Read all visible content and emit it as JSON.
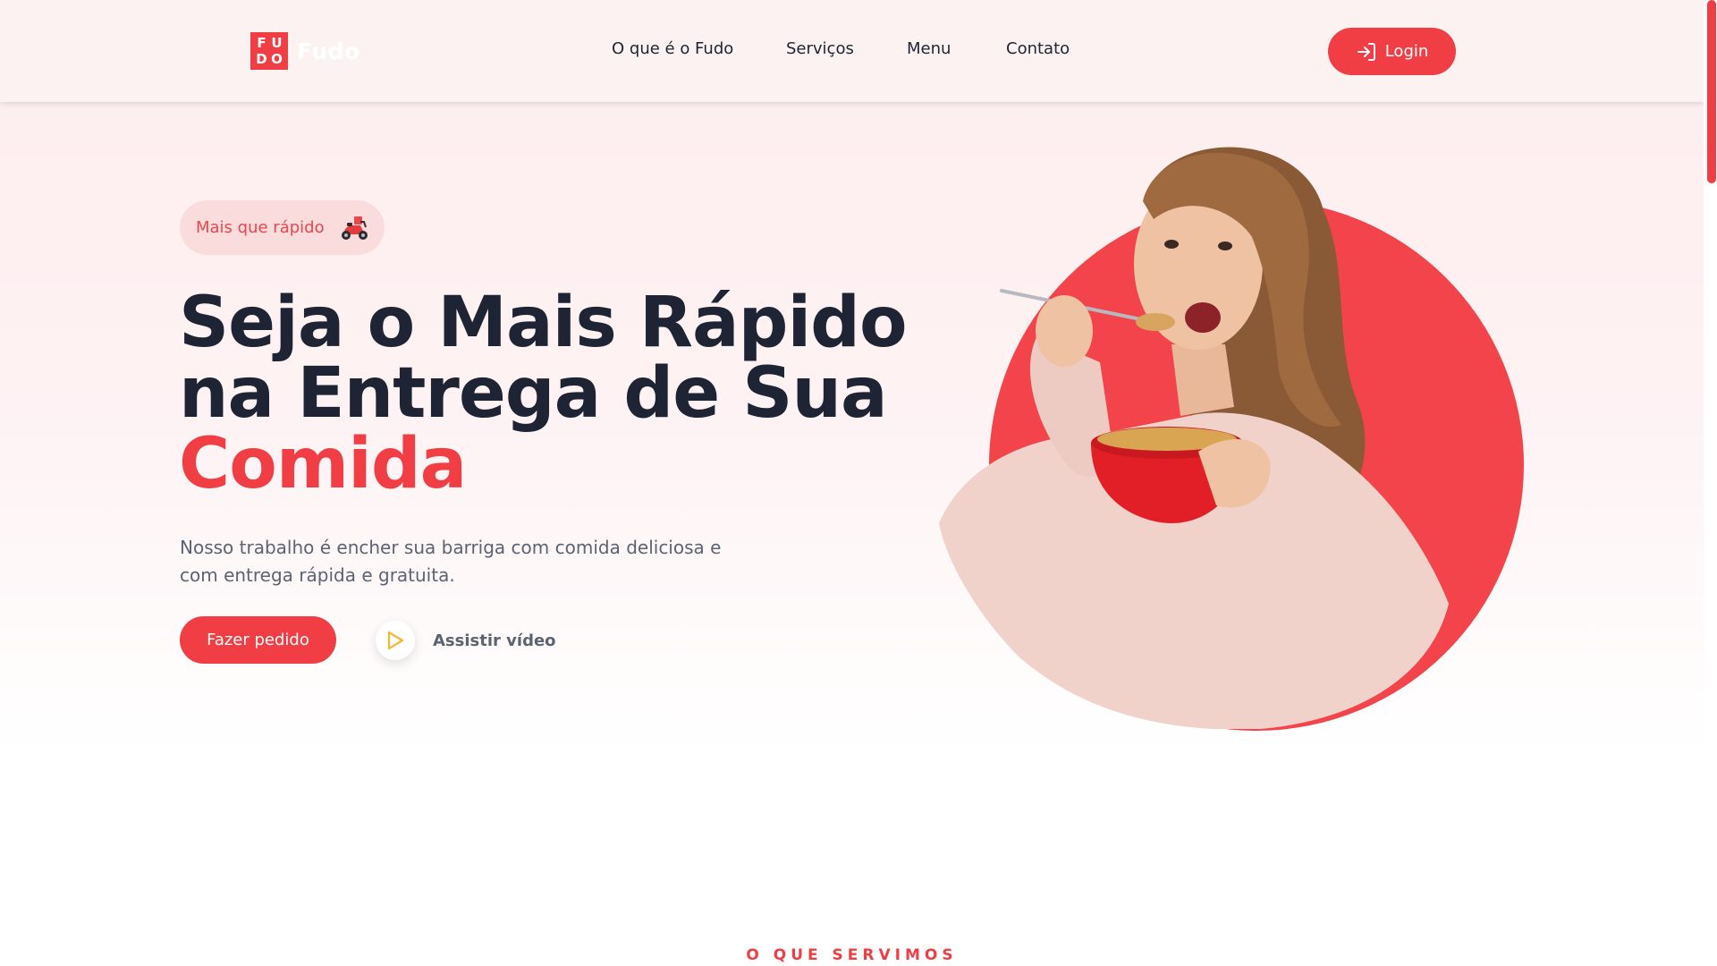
{
  "brand": {
    "logo_letters": [
      "F",
      "U",
      "D",
      "O"
    ],
    "name": "Fudo",
    "accent_color": "#f03e44"
  },
  "nav": {
    "items": [
      {
        "label": "O que é o Fudo"
      },
      {
        "label": "Serviços"
      },
      {
        "label": "Menu"
      },
      {
        "label": "Contato"
      }
    ],
    "login_label": "Login",
    "login_icon": "login-arrow-icon"
  },
  "hero": {
    "badge_text": "Mais que rápido",
    "badge_icon": "scooter-icon",
    "title_lines": [
      "Seja o Mais Rápido",
      "na Entrega de Sua"
    ],
    "title_accent": "Comida",
    "description": "Nosso trabalho é encher sua barriga com comida deliciosa e com entrega rápida e gratuita.",
    "order_button": "Fazer pedido",
    "video_label": "Assistir vídeo",
    "video_icon": "play-icon",
    "image": "woman-eating-cereal"
  },
  "services": {
    "section_label": "O QUE SERVIMOS"
  }
}
